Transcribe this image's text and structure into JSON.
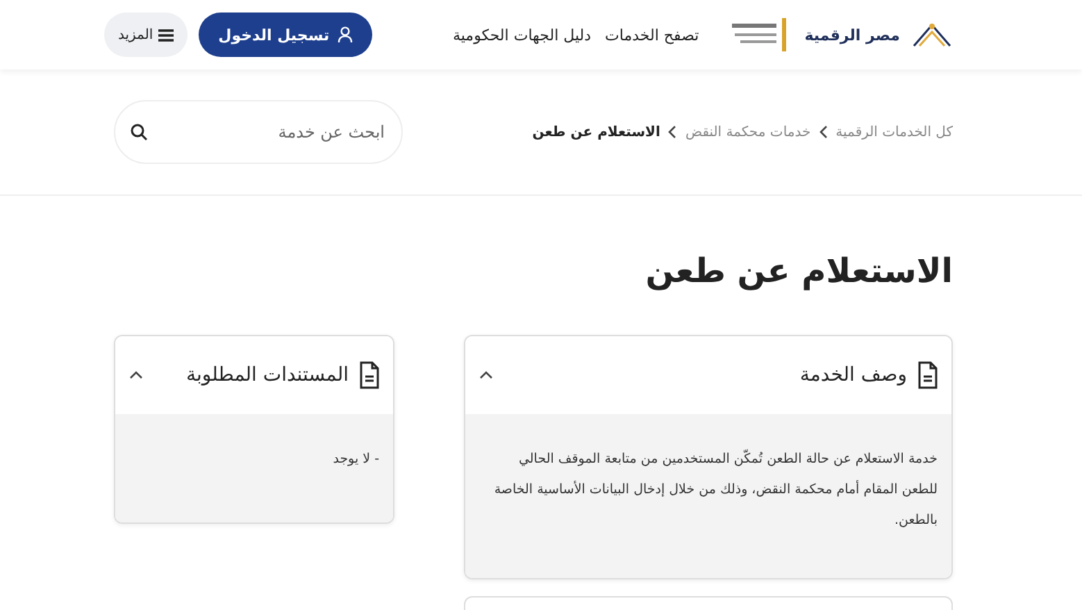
{
  "header": {
    "logo_text": "مصر الرقمية",
    "nav": [
      "تصفح الخدمات",
      "دليل الجهات الحكومية"
    ],
    "login_button": "تسجيل الدخول",
    "more_button": "المزيد"
  },
  "breadcrumb": [
    {
      "label": "كل الخدمات الرقمية",
      "current": false
    },
    {
      "label": "خدمات محكمة النقض",
      "current": false
    },
    {
      "label": "الاستعلام عن طعن",
      "current": true
    }
  ],
  "search": {
    "placeholder": "ابحث عن خدمة"
  },
  "title": "الاستعلام عن طعن",
  "main_sections": [
    {
      "title": "وصف الخدمة",
      "expanded": true,
      "body": "خدمة الاستعلام عن حالة الطعن تُمكّن المستخدمين من متابعة الموقف الحالي للطعن المقام أمام محكمة النقض، وذلك من خلال إدخال البيانات الأساسية الخاصة بالطعن."
    }
  ],
  "side_sections": [
    {
      "title": "المستندات المطلوبة",
      "expanded": true,
      "body": "- لا يوجد"
    }
  ]
}
